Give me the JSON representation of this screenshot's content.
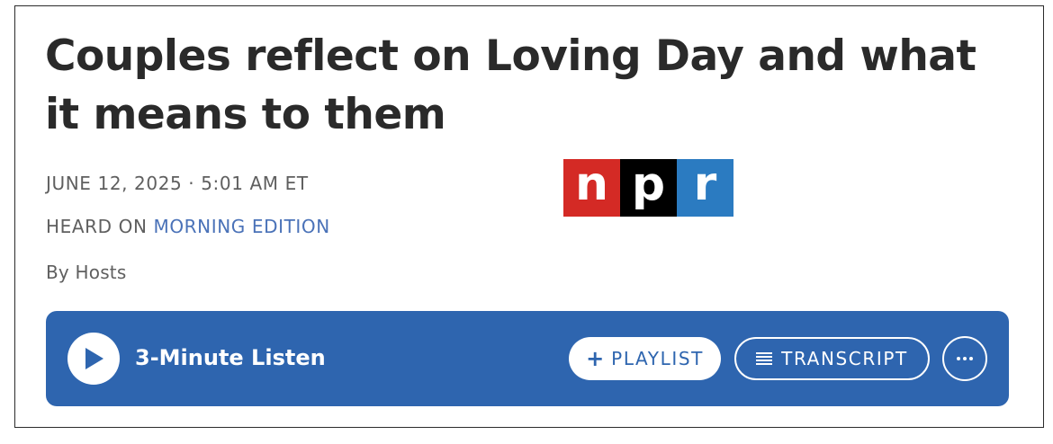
{
  "article": {
    "headline": "Couples reflect on Loving Day and what it means to them",
    "date": "JUNE 12, 2025 · 5:01 AM ET",
    "heard_on_prefix": "HEARD ON ",
    "heard_on_show": "MORNING EDITION",
    "byline": "By Hosts"
  },
  "logo": {
    "letters": [
      "n",
      "p",
      "r"
    ],
    "colors": [
      "#d42a25",
      "#000000",
      "#2b7bc1"
    ]
  },
  "player": {
    "listen_label": "3-Minute Listen",
    "playlist_icon": "+",
    "playlist_label": "PLAYLIST",
    "transcript_label": "TRANSCRIPT",
    "background_color": "#2e65af"
  },
  "icons": {
    "play": "play-icon",
    "plus": "plus-icon",
    "transcript": "transcript-lines-icon",
    "more": "more-dots-icon"
  }
}
